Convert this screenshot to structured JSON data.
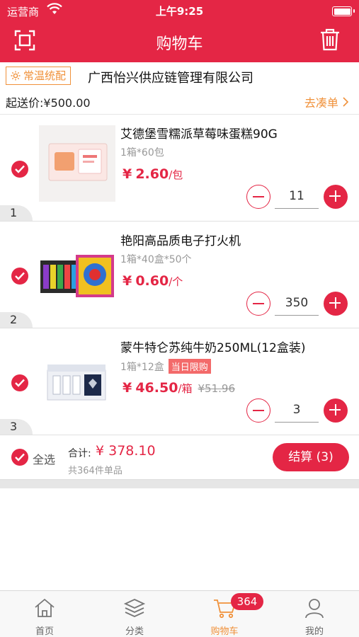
{
  "status": {
    "carrier": "运营商",
    "time": "上午9:25"
  },
  "header": {
    "title": "购物车"
  },
  "shop": {
    "tag": "常温统配",
    "name": "广西怡兴供应链管理有限公司",
    "min_amount": "起送价:¥500.00",
    "addon_label": "去凑单"
  },
  "items": [
    {
      "index": "1",
      "name": "艾德堡雪糯派草莓味蛋糕90G",
      "spec": "1箱*60包",
      "currency": "¥",
      "price": "2.60",
      "unit": "/包",
      "qty": "11"
    },
    {
      "index": "2",
      "name": "艳阳高品质电子打火机",
      "spec": "1箱*40盒*50个",
      "currency": "¥",
      "price": "0.60",
      "unit": "/个",
      "qty": "350"
    },
    {
      "index": "3",
      "name": "蒙牛特仑苏纯牛奶250ML(12盒装)",
      "spec": "1箱*12盒",
      "tag": "当日限购",
      "currency": "¥",
      "price": "46.50",
      "unit": "/箱",
      "orig_price": "¥51.96",
      "qty": "3"
    }
  ],
  "footer": {
    "select_all": "全选",
    "total_label": "合计:",
    "total_value": "¥ 378.10",
    "count_text": "共364件单品",
    "checkout_label": "结算 (3)"
  },
  "tabbar": {
    "items": [
      {
        "label": "首页",
        "icon": "home-icon"
      },
      {
        "label": "分类",
        "icon": "category-icon"
      },
      {
        "label": "购物车",
        "icon": "cart-icon"
      },
      {
        "label": "我的",
        "icon": "profile-icon"
      }
    ],
    "cart_badge": "364",
    "active_index": 2
  },
  "colors": {
    "primary": "#e42645",
    "accent": "#f0913a"
  }
}
